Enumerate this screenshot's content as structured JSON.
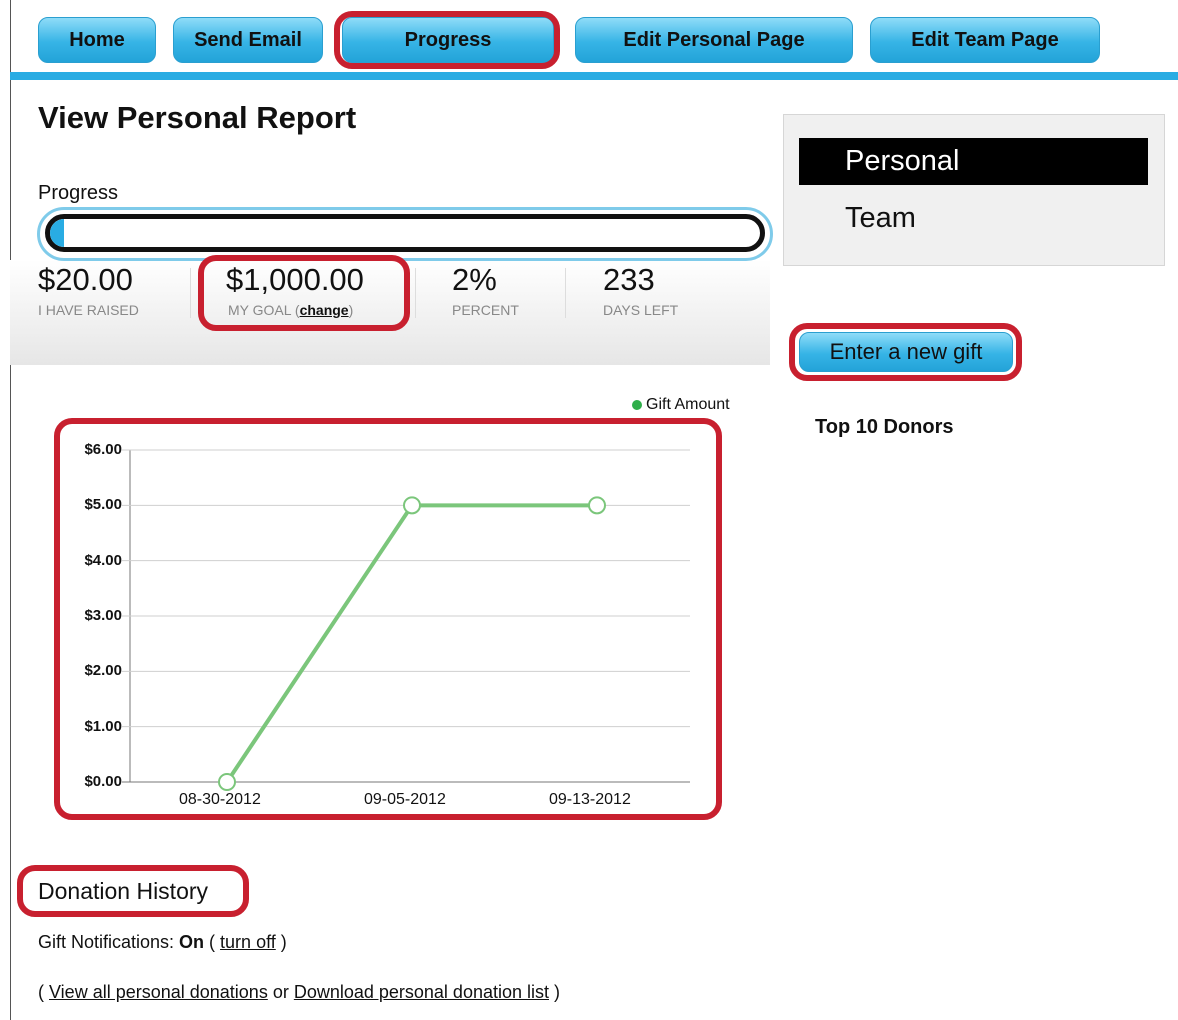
{
  "nav": {
    "home": "Home",
    "send_email": "Send Email",
    "progress": "Progress",
    "edit_personal": "Edit Personal Page",
    "edit_team": "Edit Team Page"
  },
  "page_title": "View Personal Report",
  "progress": {
    "label": "Progress",
    "fraction": 0.02,
    "raised_value": "$20.00",
    "raised_label": "I HAVE RAISED",
    "goal_value": "$1,000.00",
    "goal_label_prefix": "MY GOAL (",
    "goal_change": "change",
    "goal_label_suffix": ")",
    "percent_value": "2%",
    "percent_label": "PERCENT",
    "days_value": "233",
    "days_label": "DAYS LEFT"
  },
  "sidebar": {
    "tabs": [
      "Personal",
      "Team"
    ],
    "active_tab": "Personal",
    "gift_button": "Enter a new gift",
    "top_donors": "Top 10 Donors"
  },
  "chart_data": {
    "type": "line",
    "x": [
      "08-30-2012",
      "09-05-2012",
      "09-13-2012"
    ],
    "series": [
      {
        "name": "Gift Amount",
        "values": [
          0,
          5,
          5
        ],
        "color": "#7bc67b"
      }
    ],
    "y_ticks": [
      "$0.00",
      "$1.00",
      "$2.00",
      "$3.00",
      "$4.00",
      "$5.00",
      "$6.00"
    ],
    "ylim": [
      0,
      6
    ],
    "grid": true,
    "legend": "top-right",
    "legend_dot_color": "#2fae4a"
  },
  "donation_history": {
    "title": "Donation History",
    "notif_prefix": "Gift Notifications: ",
    "notif_state": "On",
    "notif_open": " ( ",
    "notif_link": "turn off",
    "notif_close": " )",
    "links_open": "( ",
    "view_all": "View all personal donations",
    "links_or": " or ",
    "download": "Download personal donation list",
    "links_close": " )"
  },
  "colors": {
    "accent": "#29ace3",
    "highlight": "#c8202f"
  }
}
